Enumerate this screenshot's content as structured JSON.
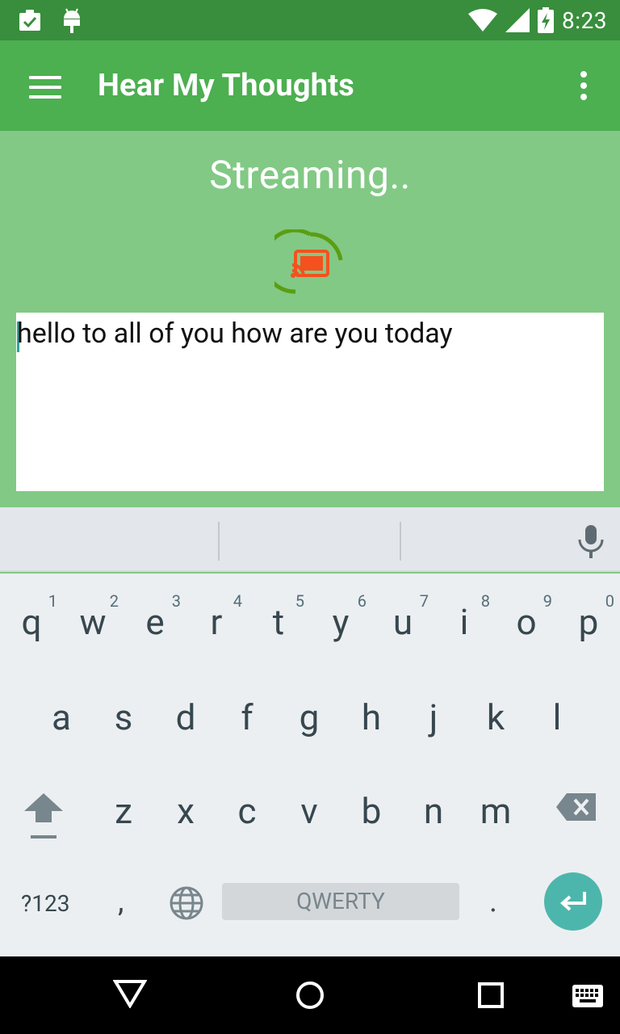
{
  "status_bar": {
    "time": "8:23",
    "icons": [
      "clipboard-check-icon",
      "android-icon",
      "wifi-icon",
      "signal-icon",
      "battery-charging-icon"
    ]
  },
  "app_bar": {
    "title": "Hear My Thoughts",
    "menu_icon": "hamburger-menu-icon",
    "overflow_icon": "more-vert-icon"
  },
  "main": {
    "status_heading": "Streaming..",
    "cast_icon": "cast-connected-icon",
    "transcript_text": "hello to all of you how are you today"
  },
  "keyboard": {
    "row1": [
      {
        "key": "q",
        "hint": "1"
      },
      {
        "key": "w",
        "hint": "2"
      },
      {
        "key": "e",
        "hint": "3"
      },
      {
        "key": "r",
        "hint": "4"
      },
      {
        "key": "t",
        "hint": "5"
      },
      {
        "key": "y",
        "hint": "6"
      },
      {
        "key": "u",
        "hint": "7"
      },
      {
        "key": "i",
        "hint": "8"
      },
      {
        "key": "o",
        "hint": "9"
      },
      {
        "key": "p",
        "hint": "0"
      }
    ],
    "row2": [
      "a",
      "s",
      "d",
      "f",
      "g",
      "h",
      "j",
      "k",
      "l"
    ],
    "row3": [
      "z",
      "x",
      "c",
      "v",
      "b",
      "n",
      "m"
    ],
    "symbols_label": "?123",
    "comma_label": ",",
    "space_label": "QWERTY",
    "period_label": ".",
    "accent_color": "#4db6ac"
  },
  "colors": {
    "status_bar": "#388e3c",
    "app_bar": "#4caf50",
    "content_bg": "#82c985"
  }
}
